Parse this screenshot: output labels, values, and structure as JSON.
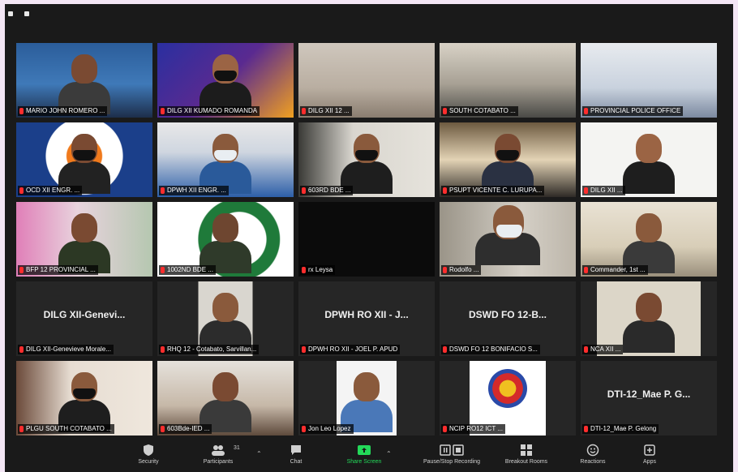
{
  "toolbar": {
    "security": "Security",
    "participants": "Participants",
    "participants_count": "31",
    "chat": "Chat",
    "share_screen": "Share Screen",
    "recording": "Pause/Stop Recording",
    "breakout": "Breakout Rooms",
    "reactions": "Reactions",
    "apps": "Apps",
    "share_color": "#23d959"
  },
  "tiles": [
    {
      "name": "MARIO JOHN ROMERO ...",
      "big": ""
    },
    {
      "name": "DILG XII KUMADO ROMANDA",
      "big": ""
    },
    {
      "name": "DILG XII 12 ...",
      "big": ""
    },
    {
      "name": "SOUTH COTABATO ...",
      "big": ""
    },
    {
      "name": "PROVINCIAL POLICE OFFICE",
      "big": ""
    },
    {
      "name": "OCD XII ENGR. ...",
      "big": ""
    },
    {
      "name": "DPWH XII ENGR. ...",
      "big": ""
    },
    {
      "name": "603RD BDE ...",
      "big": ""
    },
    {
      "name": "PSUPT VICENTE C. LURUPA...",
      "big": ""
    },
    {
      "name": "DILG XII ...",
      "big": ""
    },
    {
      "name": "BFP 12 PROVINCIAL ...",
      "big": ""
    },
    {
      "name": "1002ND BDE ...",
      "big": ""
    },
    {
      "name": "rx Leysa",
      "big": ""
    },
    {
      "name": "Rodolfo ...",
      "big": ""
    },
    {
      "name": "Commander, 1st ...",
      "big": ""
    },
    {
      "name": "DILG XII-Genevieve Morale...",
      "big": "DILG XII-Genevi..."
    },
    {
      "name": "RHQ 12 - Cotabato, Sarvillan...",
      "big": ""
    },
    {
      "name": "DPWH RO XII - JOEL P. APUD",
      "big": "DPWH RO XII - J..."
    },
    {
      "name": "DSWD FO 12 BONIFACIO S...",
      "big": "DSWD FO 12-B..."
    },
    {
      "name": "NCA XII ...",
      "big": ""
    },
    {
      "name": "PLGU SOUTH COTABATO ...",
      "big": ""
    },
    {
      "name": "603Bde-IED ...",
      "big": ""
    },
    {
      "name": "Jon Leo Lopez",
      "big": ""
    },
    {
      "name": "NCIP RO12 ICT ...",
      "big": ""
    },
    {
      "name": "DTI-12_Mae P. Gelong",
      "big": "DTI-12_Mae P. G..."
    }
  ]
}
